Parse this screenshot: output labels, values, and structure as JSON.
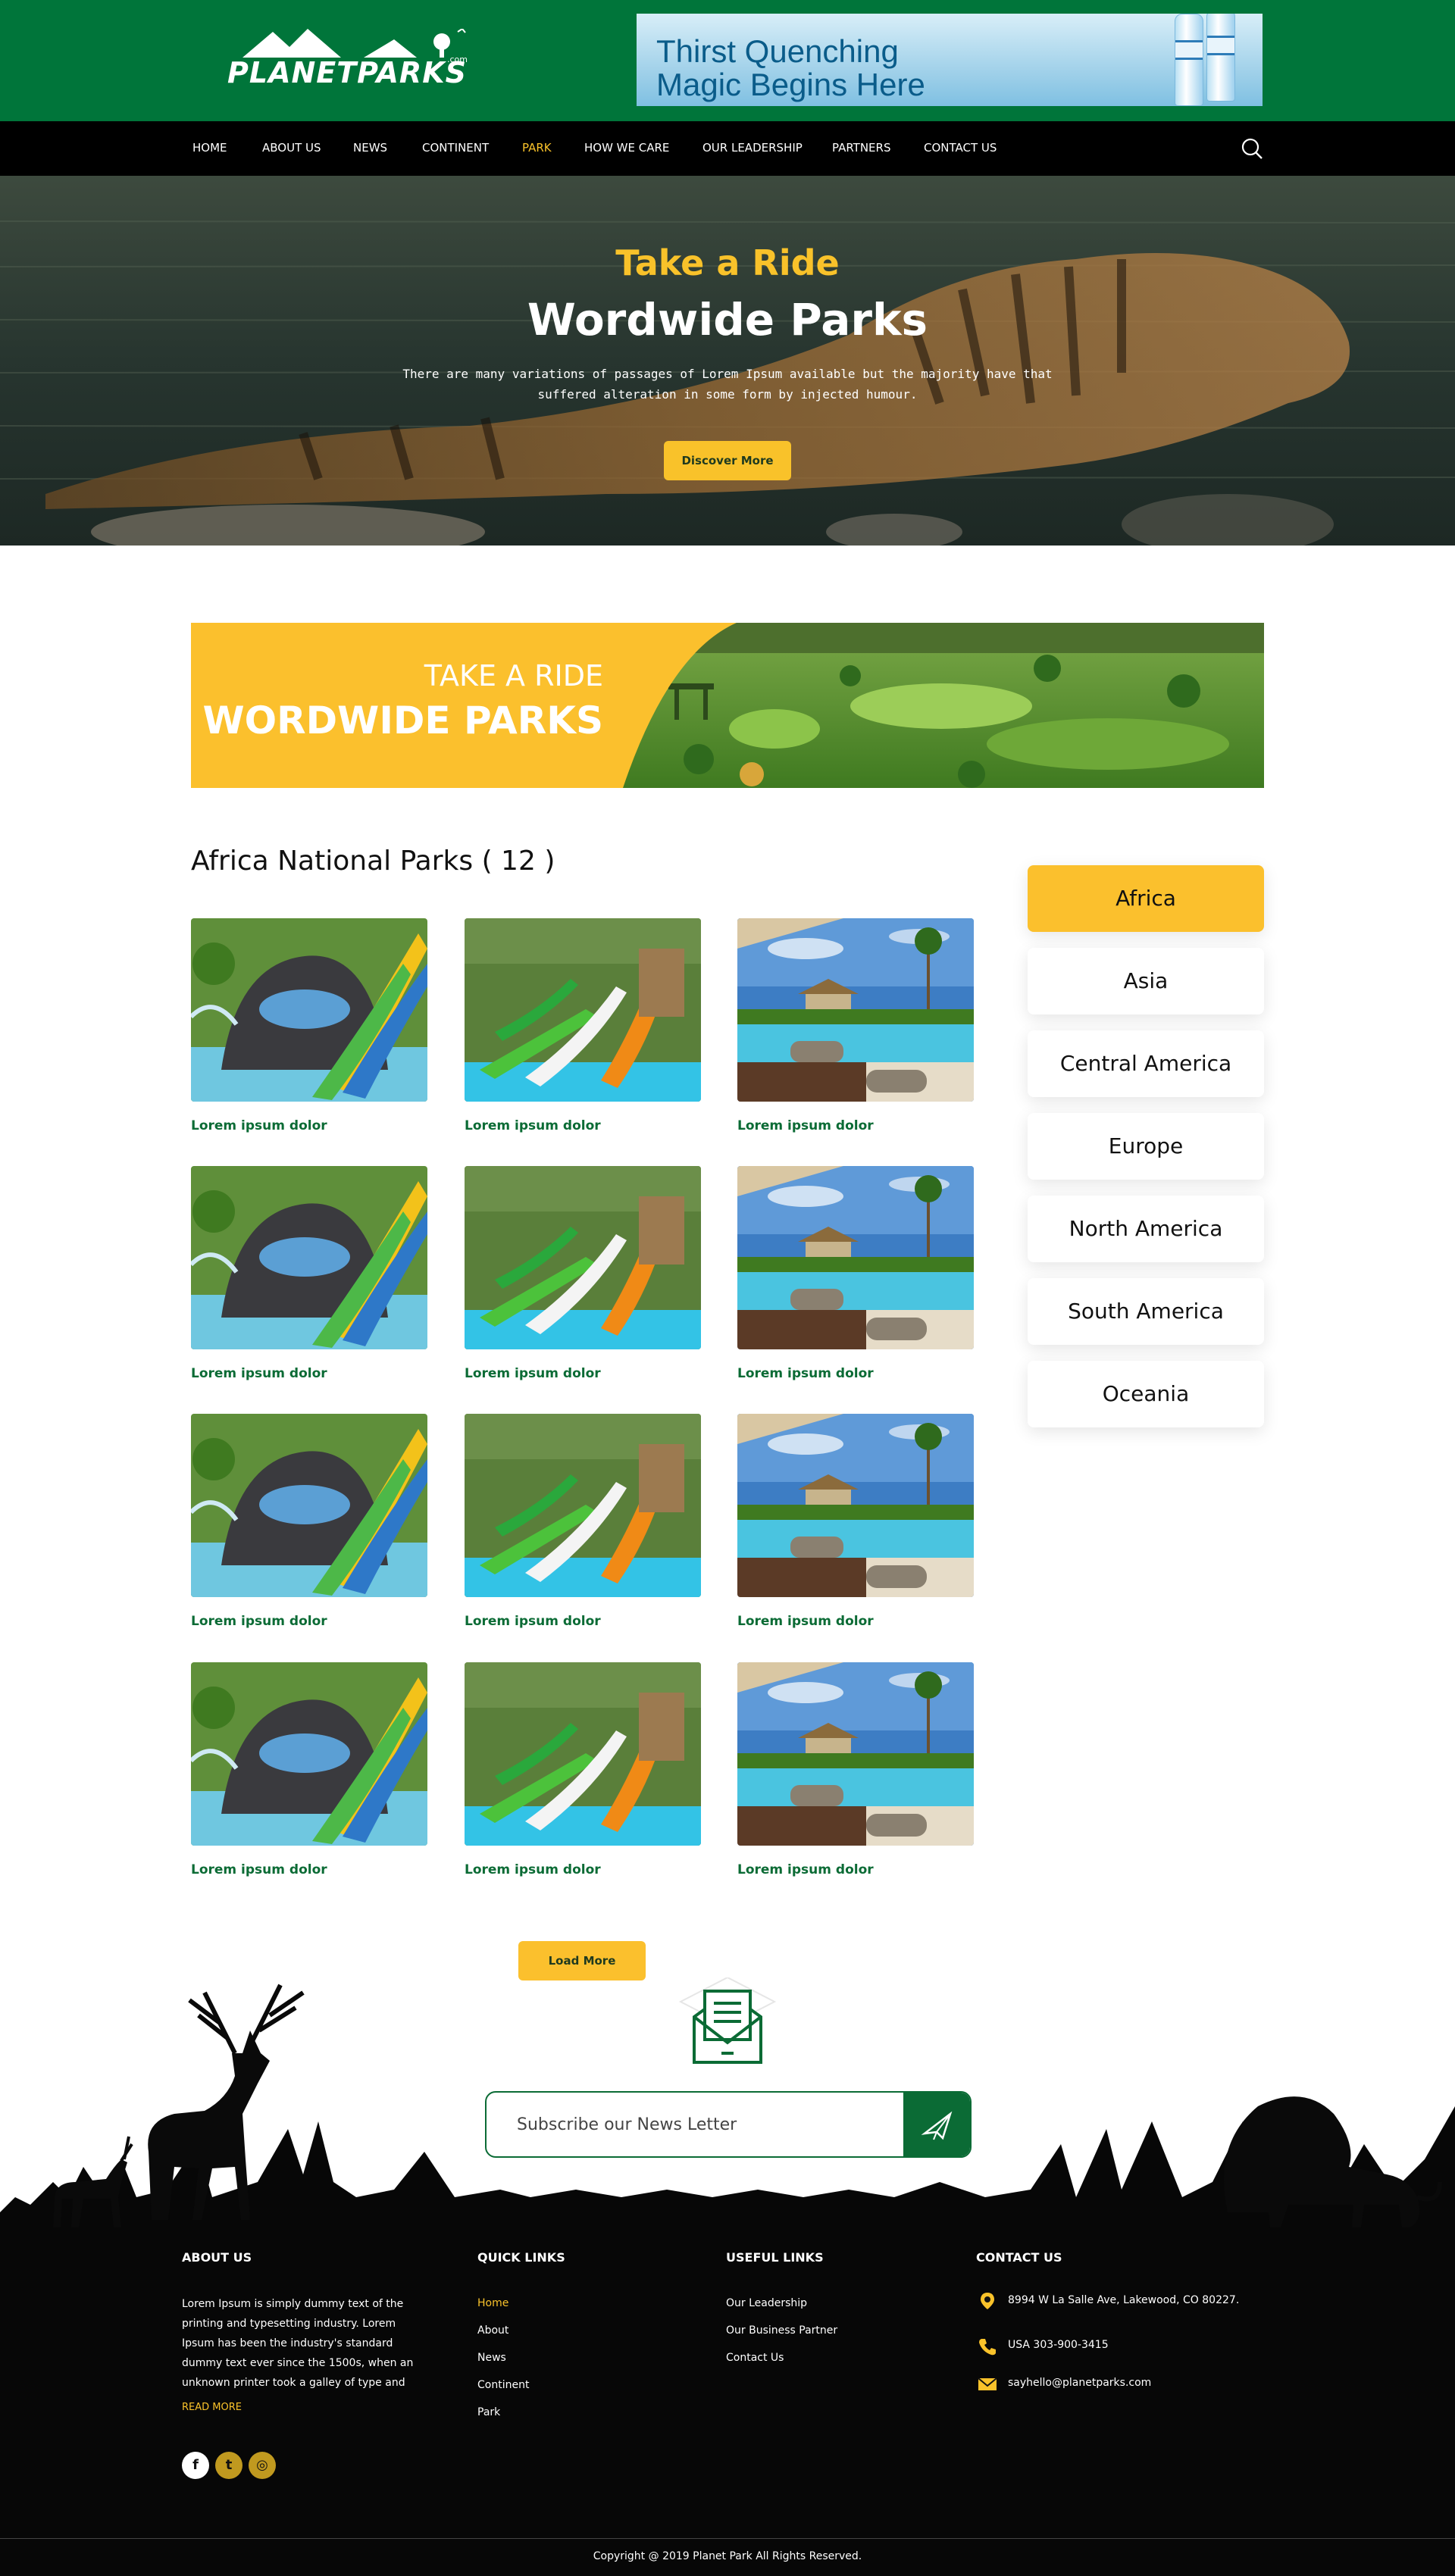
{
  "brand": {
    "logo_text": "PLANETPARKS",
    "logo_suffix": ".com",
    "colors": {
      "green": "#00753a",
      "yellow": "#fbc02d",
      "nav": "#000000"
    }
  },
  "ad": {
    "line1": "Thirst Quenching",
    "line2": "Magic Begins Here"
  },
  "nav": {
    "items": [
      {
        "label": "HOME",
        "active": false
      },
      {
        "label": "ABOUT US",
        "active": false
      },
      {
        "label": "NEWS",
        "active": false
      },
      {
        "label": "CONTINENT",
        "active": false
      },
      {
        "label": "PARK",
        "active": true
      },
      {
        "label": "HOW WE CARE",
        "active": false
      },
      {
        "label": "OUR LEADERSHIP",
        "active": false
      },
      {
        "label": "PARTNERS",
        "active": false
      },
      {
        "label": "CONTACT US",
        "active": false
      }
    ],
    "search_icon": "search-icon"
  },
  "hero": {
    "subtitle": "Take a Ride",
    "title": "Wordwide Parks",
    "description": "There are many variations of passages of Lorem Ipsum available but the majority have that suffered alteration in some form by injected humour.",
    "button": "Discover More"
  },
  "banner": {
    "line1": "TAKE A RIDE",
    "line2": "WORDWIDE PARKS"
  },
  "parks": {
    "title": "Africa National Parks ( 12 )",
    "items": [
      {
        "caption": "Lorem ipsum dolor",
        "image": "waterslide-rock"
      },
      {
        "caption": "Lorem ipsum dolor",
        "image": "waterslide-green"
      },
      {
        "caption": "Lorem ipsum dolor",
        "image": "resort-pool"
      },
      {
        "caption": "Lorem ipsum dolor",
        "image": "waterslide-rock"
      },
      {
        "caption": "Lorem ipsum dolor",
        "image": "waterslide-green"
      },
      {
        "caption": "Lorem ipsum dolor",
        "image": "resort-pool"
      },
      {
        "caption": "Lorem ipsum dolor",
        "image": "waterslide-rock"
      },
      {
        "caption": "Lorem ipsum dolor",
        "image": "waterslide-green"
      },
      {
        "caption": "Lorem ipsum dolor",
        "image": "resort-pool"
      },
      {
        "caption": "Lorem ipsum dolor",
        "image": "waterslide-rock"
      },
      {
        "caption": "Lorem ipsum dolor",
        "image": "waterslide-green"
      },
      {
        "caption": "Lorem ipsum dolor",
        "image": "resort-pool"
      }
    ],
    "load_more": "Load More"
  },
  "continents": {
    "items": [
      {
        "label": "Africa",
        "active": true
      },
      {
        "label": "Asia",
        "active": false
      },
      {
        "label": "Central America",
        "active": false
      },
      {
        "label": "Europe",
        "active": false
      },
      {
        "label": "North America",
        "active": false
      },
      {
        "label": "South America",
        "active": false
      },
      {
        "label": "Oceania",
        "active": false
      }
    ]
  },
  "newsletter": {
    "placeholder": "Subscribe our News Letter",
    "icon": "envelope-icon",
    "send_icon": "paper-plane-icon"
  },
  "footer": {
    "about": {
      "heading": "ABOUT US",
      "lines": [
        "Lorem Ipsum is simply dummy text of the",
        "printing and typesetting industry. Lorem",
        "Ipsum has been the industry's standard",
        "dummy text ever since the 1500s, when an",
        "unknown printer took a galley of type and"
      ],
      "read_more": "READ MORE",
      "social": [
        {
          "icon": "facebook-icon",
          "glyph": "f"
        },
        {
          "icon": "twitter-icon",
          "glyph": "t"
        },
        {
          "icon": "instagram-icon",
          "glyph": "◎"
        }
      ]
    },
    "quick_links": {
      "heading": "QUICK LINKS",
      "items": [
        {
          "label": "Home",
          "active": true
        },
        {
          "label": "About",
          "active": false
        },
        {
          "label": "News",
          "active": false
        },
        {
          "label": "Continent",
          "active": false
        },
        {
          "label": "Park",
          "active": false
        }
      ]
    },
    "useful_links": {
      "heading": "USEFUL LINKS",
      "items": [
        {
          "label": "Our Leadership"
        },
        {
          "label": "Our Business Partner"
        },
        {
          "label": "Contact Us"
        }
      ]
    },
    "contact": {
      "heading": "CONTACT US",
      "items": [
        {
          "icon": "location-pin-icon",
          "text": "8994 W La Salle Ave, Lakewood, CO 80227."
        },
        {
          "icon": "phone-icon",
          "text": "USA 303-900-3415"
        },
        {
          "icon": "mail-icon",
          "text": "sayhello@planetparks.com"
        }
      ]
    },
    "copyright": "Copyright @ 2019 Planet Park All Rights Reserved."
  }
}
